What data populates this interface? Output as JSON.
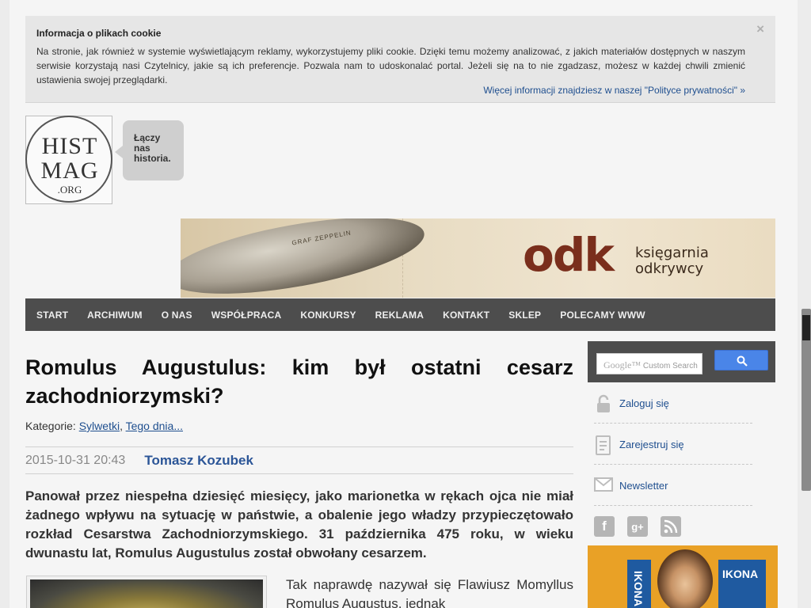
{
  "cookie": {
    "title": "Informacja o plikach cookie",
    "text": "Na stronie, jak również w systemie wyświetlającym reklamy, wykorzystujemy pliki cookie. Dzięki temu możemy analizować, z jakich materiałów dostępnych w naszym serwisie korzystają nasi Czytelnicy, jakie są ich preferencje. Pozwala nam to udoskonalać portal. Jeżeli się na to nie zgadzasz, możesz w każdej chwili zmienić ustawienia swojej przeglądarki.",
    "more_link": "Więcej informacji znajdziesz w naszej \"Polityce prywatności\" »",
    "close": "×"
  },
  "logo": {
    "line1": "HIST",
    "line2": "MAG",
    "line3": ".ORG",
    "tagline_1": "Łączy",
    "tagline_2": "nas",
    "tagline_3": "historia."
  },
  "banner": {
    "zeppelin_text": "GRAF ZEPPELIN",
    "brand": "odk",
    "subtitle_1": "księgarnia",
    "subtitle_2": "odkrywcy"
  },
  "nav": {
    "items": [
      "START",
      "ARCHIWUM",
      "O NAS",
      "WSPÓŁPRACA",
      "KONKURSY",
      "REKLAMA",
      "KONTAKT",
      "SKLEP",
      "POLECAMY WWW"
    ]
  },
  "article": {
    "title": "Romulus Augustulus: kim był ostatni cesarz zachodniorzymski?",
    "categories_label": "Kategorie:",
    "category_1": "Sylwetki",
    "category_sep": ",",
    "category_2": "Tego dnia...",
    "date": "2015-10-31 20:43",
    "author": "Tomasz Kozubek",
    "lead": "Panował przez niespełna dziesięć miesięcy, jako marionetka w rękach ojca nie miał żadnego wpływu na sytuację w państwie, a obalenie jego władzy przypieczętowało rozkład Cesarstwa Zachodniorzymskiego. 31 października 475 roku, w wieku dwunastu lat, Romulus Augustulus został obwołany cesarzem.",
    "body": "Tak naprawdę nazywał się Flawiusz Momyllus Romulus Augustus, jednak"
  },
  "sidebar": {
    "search_placeholder": "Custom Search",
    "search_brand": "Google™",
    "login": "Zaloguj się",
    "register": "Zarejestruj się",
    "newsletter": "Newsletter",
    "ad_book_1": "IKONA",
    "ad_book_2": "IKONA"
  }
}
